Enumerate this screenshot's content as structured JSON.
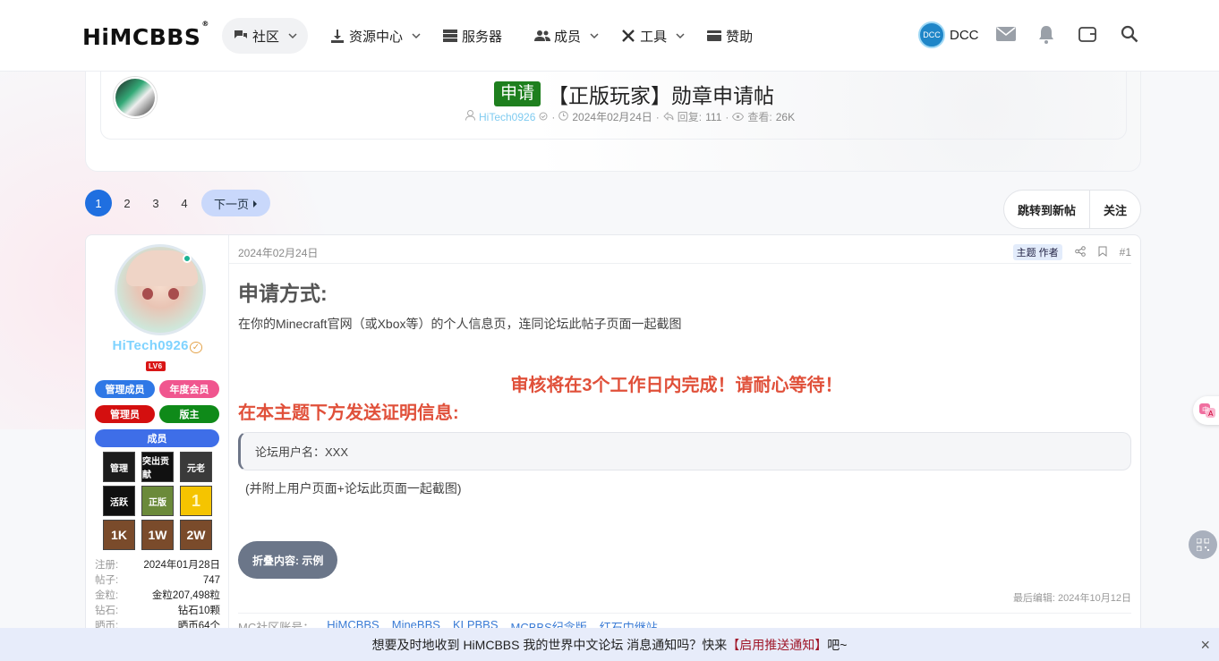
{
  "header": {
    "logo": "HiMCBBS",
    "logo_mark": "®",
    "nav": [
      {
        "label": "社区",
        "icon": "chat-icon",
        "dropdown": true,
        "active": true
      },
      {
        "label": "资源中心",
        "icon": "download-icon",
        "dropdown": true
      },
      {
        "label": "服务器",
        "icon": "server-icon",
        "dropdown": false
      },
      {
        "label": "成员",
        "icon": "users-icon",
        "dropdown": true
      },
      {
        "label": "工具",
        "icon": "tools-icon",
        "dropdown": true
      },
      {
        "label": "赞助",
        "icon": "card-icon",
        "dropdown": false
      }
    ],
    "user_name": "DCC",
    "user_avatar_text": "DCC"
  },
  "thread": {
    "prefix": "申请",
    "title": "【正版玩家】勋章申请帖",
    "author": "HiTech0926",
    "date": "2024年02月24日",
    "replies_label": "回复:",
    "replies": "111",
    "views_label": "查看:",
    "views": "26K"
  },
  "pagination": {
    "pages": [
      "1",
      "2",
      "3",
      "4"
    ],
    "current": "1",
    "next_label": "下一页"
  },
  "thread_actions": {
    "jump_new": "跳转到新帖",
    "follow": "关注"
  },
  "post": {
    "user": {
      "name": "HiTech0926",
      "level": "LV6",
      "badges": [
        {
          "label": "管理成员",
          "color": "#2f78e6"
        },
        {
          "label": "年度会员",
          "color": "#f0568f"
        },
        {
          "label": "管理员",
          "color": "#d40f0f"
        },
        {
          "label": "版主",
          "color": "#0f8a19"
        },
        {
          "label": "成员",
          "color": "#3e6ee8"
        }
      ],
      "medals": [
        "管理",
        "突出贡献",
        "元老",
        "活跃",
        "正版",
        "1",
        "1K",
        "1W",
        "2W"
      ],
      "stats": [
        {
          "k": "注册:",
          "v": "2024年01月28日"
        },
        {
          "k": "帖子:",
          "v": "747"
        },
        {
          "k": "金粒:",
          "v": "金粒207,498粒"
        },
        {
          "k": "钻石:",
          "v": "钻石10颗"
        },
        {
          "k": "晒币:",
          "v": "晒币64个"
        }
      ]
    },
    "date": "2024年02月24日",
    "op_badge": "主题 作者",
    "number": "#1",
    "heading": "申请方式:",
    "intro": "在你的Minecraft官网（或Xbox等）的个人信息页，连同论坛此帖子页面一起截图",
    "notice": "审核将在3个工作日内完成！请耐心等待！",
    "send_heading": "在本主题下方发送证明信息:",
    "quote": "论坛用户名：XXX",
    "attach_note": "(并附上用户页面+论坛此页面一起截图)",
    "fold_button": "折叠内容: 示例",
    "last_edit": "最后编辑: 2024年10月12日",
    "signature_label": "MC社区账号：",
    "signature_links": [
      "HiMCBBS",
      "MineBBS",
      "KLPBBS",
      "MCBBS纪念版",
      "红石中继站"
    ]
  },
  "notice_bar": {
    "text_before": "想要及时地收到 HiMCBBS 我的世界中文论坛 消息通知吗？快来",
    "link": "【启用推送通知】",
    "text_after": "吧~",
    "close": "×"
  }
}
